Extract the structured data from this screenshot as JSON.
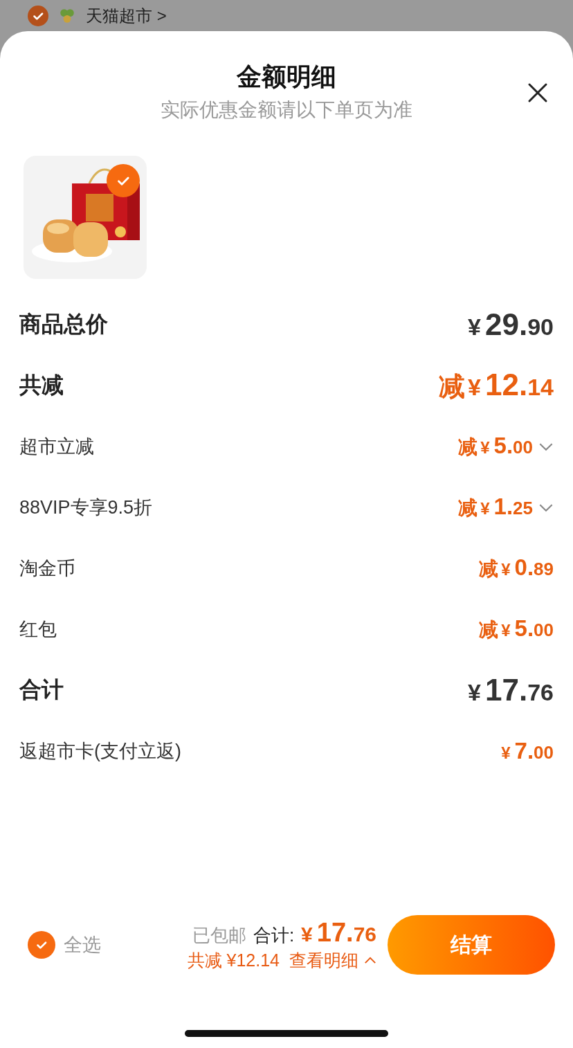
{
  "background_store": {
    "checked": true,
    "name": "天猫超市 >"
  },
  "sheet": {
    "title": "金额明细",
    "subtitle": "实际优惠金额请以下单页为准"
  },
  "product": {
    "checked": true
  },
  "rows": [
    {
      "label": "商品总价",
      "kind": "major",
      "highlight": false,
      "dropdown": false,
      "prefix": "",
      "currency": "¥",
      "integer": "29.",
      "decimal": "90"
    },
    {
      "label": "共减",
      "kind": "major",
      "highlight": true,
      "dropdown": false,
      "prefix": "减",
      "currency": "¥",
      "integer": "12.",
      "decimal": "14"
    },
    {
      "label": "超市立减",
      "kind": "minor",
      "highlight": true,
      "dropdown": true,
      "prefix": "减",
      "currency": "¥",
      "integer": "5.",
      "decimal": "00"
    },
    {
      "label": "88VIP专享9.5折",
      "kind": "minor",
      "highlight": true,
      "dropdown": true,
      "prefix": "减",
      "currency": "¥",
      "integer": "1.",
      "decimal": "25"
    },
    {
      "label": "淘金币",
      "kind": "minor",
      "highlight": true,
      "dropdown": false,
      "prefix": "减",
      "currency": "¥",
      "integer": "0.",
      "decimal": "89"
    },
    {
      "label": "红包",
      "kind": "minor",
      "highlight": true,
      "dropdown": false,
      "prefix": "减",
      "currency": "¥",
      "integer": "5.",
      "decimal": "00"
    },
    {
      "label": "合计",
      "kind": "major",
      "highlight": false,
      "dropdown": false,
      "prefix": "",
      "currency": "¥",
      "integer": "17.",
      "decimal": "76"
    },
    {
      "label": "返超市卡(支付立返)",
      "kind": "minor",
      "highlight": true,
      "dropdown": false,
      "prefix": "",
      "currency": "¥",
      "integer": "7.",
      "decimal": "00"
    }
  ],
  "footer": {
    "select_all": {
      "label": "全选",
      "checked": true
    },
    "shipping": "已包邮",
    "total_label": "合计:",
    "total_currency": "¥",
    "total_integer": "17.",
    "total_decimal": "76",
    "saved": "共减 ¥12.14",
    "details_link": "查看明细",
    "checkout": "结算"
  }
}
